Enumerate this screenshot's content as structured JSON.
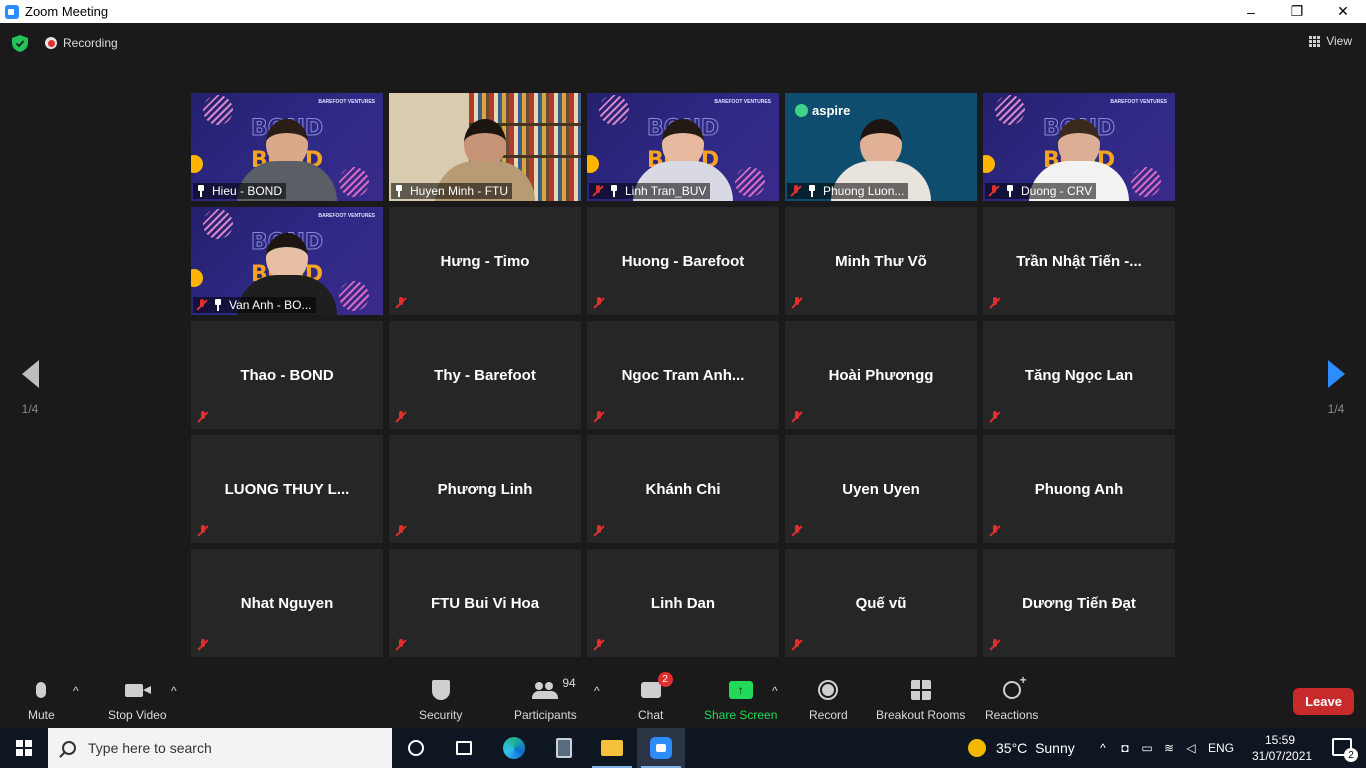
{
  "window": {
    "title": "Zoom Meeting",
    "controls": [
      "–",
      "❐",
      "✕"
    ]
  },
  "top": {
    "recording_label": "Recording",
    "view_label": "View"
  },
  "pager": {
    "left": "1/4",
    "right": "1/4"
  },
  "tiles": [
    {
      "name": "Hieu - BOND",
      "video": "bond",
      "pinned": true,
      "muted": false
    },
    {
      "name": "Huyen Minh - FTU",
      "video": "books",
      "pinned": true,
      "muted": false,
      "active": true
    },
    {
      "name": "Linh Tran_BUV",
      "video": "bond",
      "pinned": true,
      "muted": true
    },
    {
      "name": "Phuong Luon...",
      "video": "aspire",
      "pinned": true,
      "muted": true
    },
    {
      "name": "Duong - CRV",
      "video": "bond",
      "pinned": true,
      "muted": true
    },
    {
      "name": "Van Anh - BO...",
      "video": "bond",
      "pinned": true,
      "muted": true
    },
    {
      "name": "Hưng - Timo"
    },
    {
      "name": "Huong - Barefoot"
    },
    {
      "name": "Minh Thư Võ"
    },
    {
      "name": "Trần Nhật Tiến -..."
    },
    {
      "name": "Thao - BOND"
    },
    {
      "name": "Thy - Barefoot"
    },
    {
      "name": "Ngoc Tram Anh..."
    },
    {
      "name": "Hoài Phươngg"
    },
    {
      "name": "Tăng Ngọc Lan"
    },
    {
      "name": "LUONG THUY L..."
    },
    {
      "name": "Phương Linh"
    },
    {
      "name": "Khánh Chi"
    },
    {
      "name": "Uyen Uyen"
    },
    {
      "name": "Phuong Anh"
    },
    {
      "name": "Nhat Nguyen"
    },
    {
      "name": "FTU Bui Vi Hoa"
    },
    {
      "name": "Linh Dan"
    },
    {
      "name": "Quế vũ"
    },
    {
      "name": "Dương Tiến Đạt"
    }
  ],
  "video_backgrounds": {
    "bond_text": "BOND",
    "bv_text": "BAREFOOT VENTURES",
    "aspire_text": "aspire"
  },
  "toolbar": {
    "mute": "Mute",
    "stop_video": "Stop Video",
    "security": "Security",
    "participants": "Participants",
    "participants_count": "94",
    "chat": "Chat",
    "chat_badge": "2",
    "share_screen": "Share Screen",
    "record": "Record",
    "breakout_rooms": "Breakout Rooms",
    "reactions": "Reactions",
    "leave": "Leave",
    "caret": "^"
  },
  "taskbar": {
    "search_placeholder": "Type here to search",
    "weather_temp": "35°C",
    "weather_text": "Sunny",
    "language": "ENG",
    "time": "15:59",
    "date": "31/07/2021",
    "notifications": "2"
  },
  "colors": {
    "accent": "#2d8cff",
    "active_speaker": "#c6e34a",
    "leave": "#c72a2a",
    "muted": "#e02f2f",
    "share": "#23d959"
  }
}
